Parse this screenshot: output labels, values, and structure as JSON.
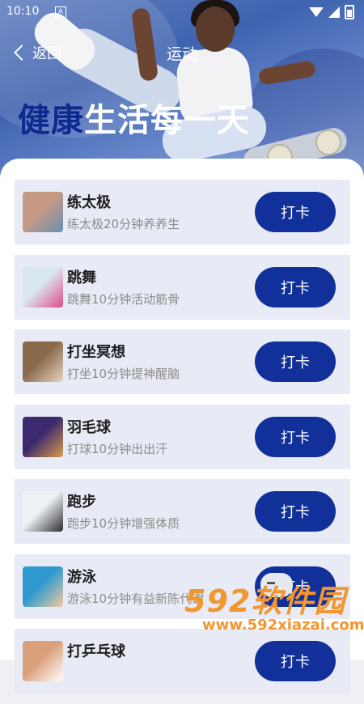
{
  "status_bar": {
    "time": "10:10",
    "notif_badge": "A"
  },
  "nav": {
    "back_label": "返回",
    "title": "运动"
  },
  "hero": {
    "slogan_accent": "健康",
    "slogan_rest": "生活每一天"
  },
  "activities": [
    {
      "title": "练太极",
      "subtitle": "练太极20分钟养养生",
      "button": "打卡",
      "thumb_colors": [
        "#c79a86",
        "#6a8fb1"
      ]
    },
    {
      "title": "跳舞",
      "subtitle": "跳舞10分钟活动筋骨",
      "button": "打卡",
      "thumb_colors": [
        "#d9e7f1",
        "#e04a8a"
      ]
    },
    {
      "title": "打坐冥想",
      "subtitle": "打坐10分钟提神醒脑",
      "button": "打卡",
      "thumb_colors": [
        "#8a6a4c",
        "#e8d6c2"
      ]
    },
    {
      "title": "羽毛球",
      "subtitle": "打球10分钟出出汗",
      "button": "打卡",
      "thumb_colors": [
        "#3b2a6e",
        "#d99a4a"
      ]
    },
    {
      "title": "跑步",
      "subtitle": "跑步10分钟增强体质",
      "button": "打卡",
      "thumb_colors": [
        "#eef2f5",
        "#2a2a2a"
      ]
    },
    {
      "title": "游泳",
      "subtitle": "游泳10分钟有益新陈代谢",
      "button": "打卡",
      "thumb_colors": [
        "#2f9ad0",
        "#f0c9a0"
      ]
    },
    {
      "title": "打乒乓球",
      "subtitle": "",
      "button": "打卡",
      "thumb_colors": [
        "#d9a07a",
        "#ffffff"
      ]
    }
  ],
  "watermark": {
    "logo_text": "592软件园",
    "url": "www.592xiazai.com"
  },
  "colors": {
    "accent": "#12309a",
    "slogan_accent": "#0e2a8f",
    "card_bg": "#e8ebf5"
  }
}
